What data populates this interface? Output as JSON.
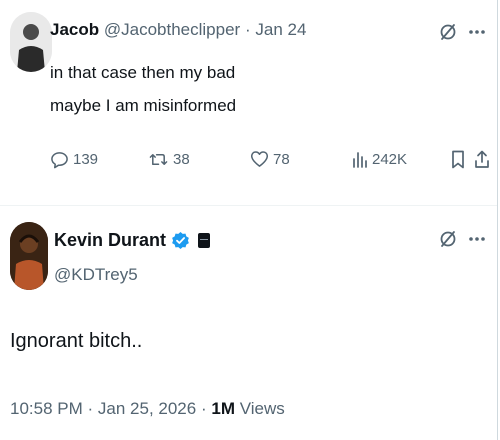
{
  "reply": {
    "name": "Jacob",
    "handle": "@Jacobtheclipper",
    "separator": "·",
    "date": "Jan 24",
    "lines": [
      "in that case then my bad",
      "maybe I am misinformed"
    ],
    "actions": {
      "replies": "139",
      "reposts": "38",
      "likes": "78",
      "views": "242K"
    }
  },
  "main": {
    "name": "Kevin Durant",
    "handle": "@KDTrey5",
    "text": "Ignorant bitch..",
    "time": "10:58 PM",
    "separator": "·",
    "date": "Jan 25, 2026",
    "separator2": "·",
    "views_count": "1M",
    "views_label": "Views"
  },
  "colors": {
    "muted": "#536471",
    "text": "#0f1419",
    "verified": "#1d9bf0"
  },
  "icons": [
    "grok-icon",
    "more-icon",
    "reply-icon",
    "repost-icon",
    "like-icon",
    "views-icon",
    "bookmark-icon",
    "share-icon",
    "verified-badge-icon",
    "affiliate-badge-icon"
  ]
}
